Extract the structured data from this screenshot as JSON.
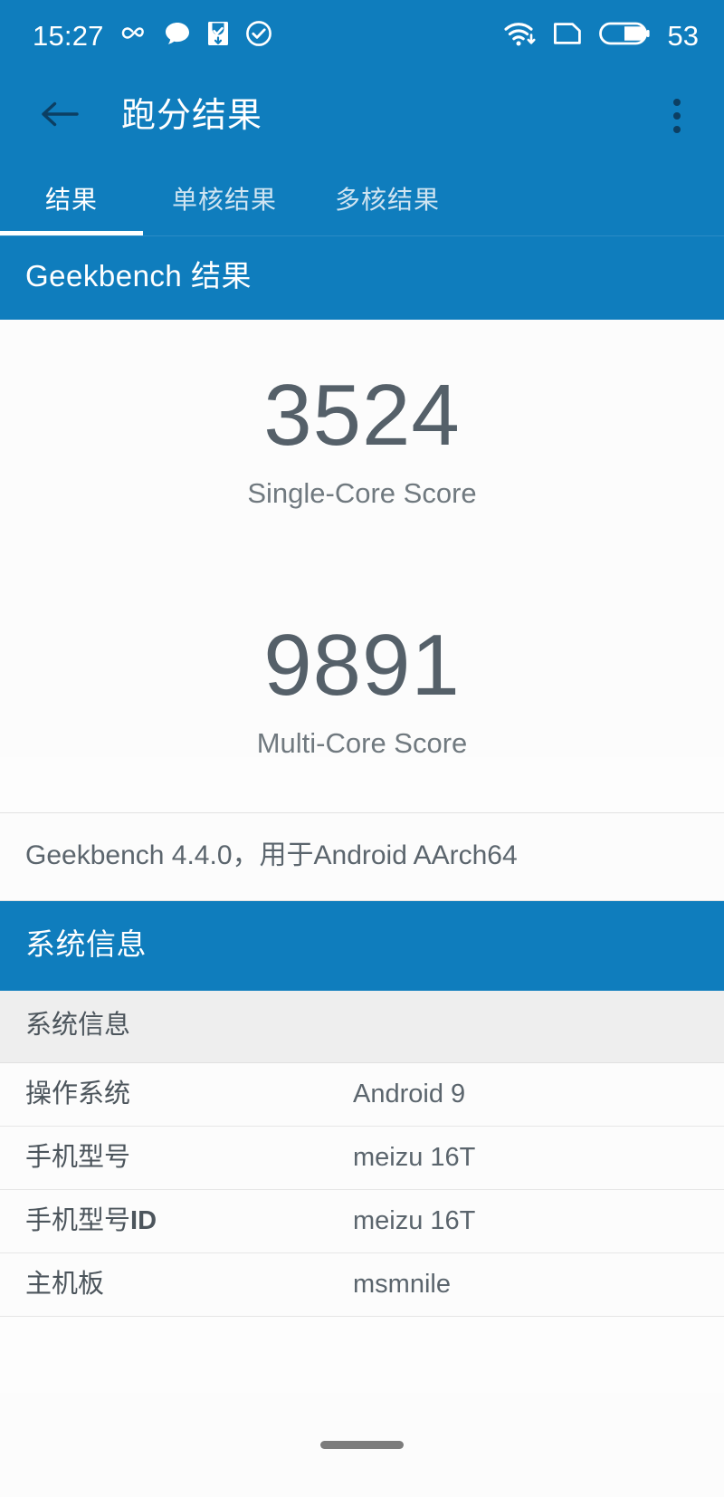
{
  "status_bar": {
    "clock": "15:27",
    "icons": [
      "infinity-icon",
      "chat-bubble-icon",
      "download-inbox-icon",
      "check-circle-icon"
    ],
    "wifi_icon": "wifi-download-icon",
    "sim_icon": "sim-card-icon",
    "battery_icon": "battery-icon",
    "battery_percent": "53"
  },
  "app_bar": {
    "back_icon": "back-arrow-icon",
    "title": "跑分结果",
    "overflow_icon": "overflow-menu-icon"
  },
  "tabs": [
    {
      "label": "结果",
      "active": true
    },
    {
      "label": "单核结果",
      "active": false
    },
    {
      "label": "多核结果",
      "active": false
    }
  ],
  "results_header": "Geekbench 结果",
  "scores": [
    {
      "value": "3524",
      "label": "Single-Core Score"
    },
    {
      "value": "9891",
      "label": "Multi-Core Score"
    }
  ],
  "version_line": "Geekbench 4.4.0，用于Android AArch64",
  "system_section": {
    "header": "系统信息",
    "subhead": "系统信息",
    "rows": [
      {
        "key": "操作系统",
        "key_bold": "",
        "value": "Android 9"
      },
      {
        "key": "手机型号",
        "key_bold": "",
        "value": "meizu 16T"
      },
      {
        "key": "手机型号",
        "key_bold": "ID",
        "value": "meizu 16T"
      },
      {
        "key": "主机板",
        "key_bold": "",
        "value": "msmnile"
      }
    ]
  },
  "nav_bar": {
    "pill": "home-gesture-pill"
  },
  "colors": {
    "brand_blue": "#0f7dbd",
    "score_gray": "#556069",
    "subhead_gray": "#eeeeee"
  }
}
